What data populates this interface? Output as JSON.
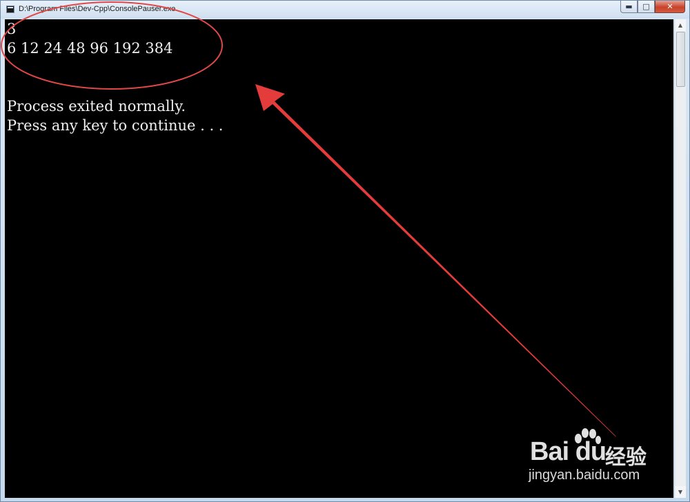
{
  "window": {
    "title": "D:\\Program Files\\Dev-Cpp\\ConsolePauser.exe",
    "controls": {
      "minimize": "▬",
      "maximize": "□",
      "close": "✕"
    }
  },
  "console": {
    "lines": [
      "3",
      "6 12 24 48 96 192 384",
      "",
      "",
      "Process exited normally.",
      "Press any key to continue . . ."
    ]
  },
  "watermark": {
    "logo": "Bai du",
    "logo_suffix": "经验",
    "url": "jingyan.baidu.com"
  },
  "annotations": {
    "circle_color": "#e04848",
    "arrow_color": "#e43b3b"
  },
  "icons": {
    "window": "console-window-icon",
    "scroll_up": "scroll-up-arrow-icon",
    "scroll_down": "scroll-down-arrow-icon"
  }
}
